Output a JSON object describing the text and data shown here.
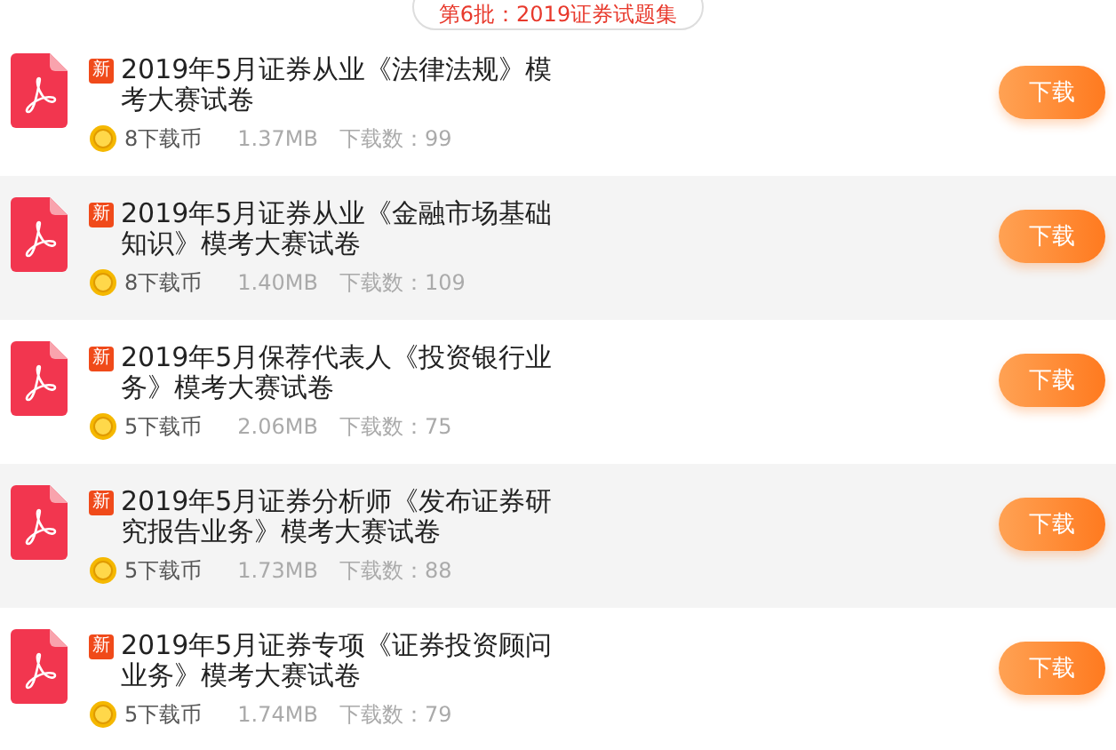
{
  "header": {
    "label": "第6批：2019证券试题集"
  },
  "files": [
    {
      "badge": "新",
      "title": "2019年5月证券从业《法律法规》模考大赛试卷",
      "cost": "8下载币",
      "size": "1.37MB",
      "downloads": "下载数：99",
      "button": "下载"
    },
    {
      "badge": "新",
      "title": "2019年5月证券从业《金融市场基础知识》模考大赛试卷",
      "cost": "8下载币",
      "size": "1.40MB",
      "downloads": "下载数：109",
      "button": "下载"
    },
    {
      "badge": "新",
      "title": "2019年5月保荐代表人《投资银行业务》模考大赛试卷",
      "cost": "5下载币",
      "size": "2.06MB",
      "downloads": "下载数：75",
      "button": "下载"
    },
    {
      "badge": "新",
      "title": "2019年5月证券分析师《发布证券研究报告业务》模考大赛试卷",
      "cost": "5下载币",
      "size": "1.73MB",
      "downloads": "下载数：88",
      "button": "下载"
    },
    {
      "badge": "新",
      "title": "2019年5月证券专项《证券投资顾问业务》模考大赛试卷",
      "cost": "5下载币",
      "size": "1.74MB",
      "downloads": "下载数：79",
      "button": "下载"
    }
  ]
}
